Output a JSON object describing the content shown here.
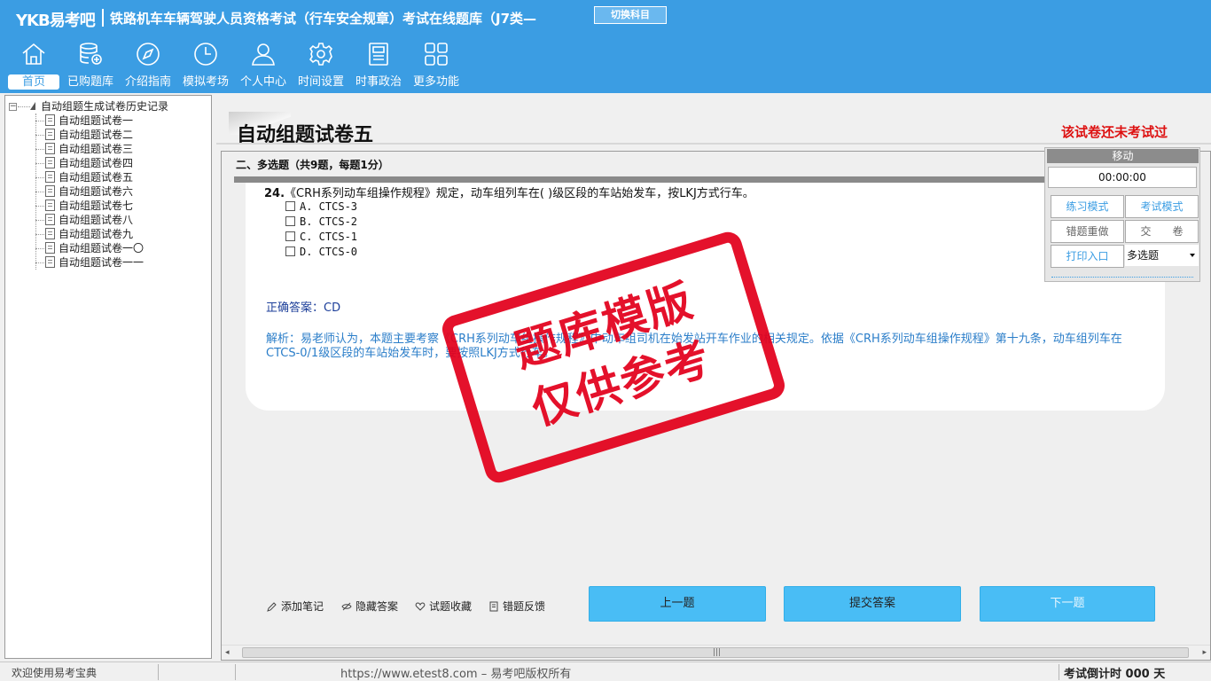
{
  "header": {
    "logo": "YKB易考吧",
    "title": "铁路机车车辆驾驶人员资格考试（行车安全规章）考试在线题库（J7类—",
    "switch_label": "切换科目",
    "nav": [
      {
        "label": "首页",
        "icon": "home-icon"
      },
      {
        "label": "已购题库",
        "icon": "database-icon"
      },
      {
        "label": "介绍指南",
        "icon": "compass-icon"
      },
      {
        "label": "模拟考场",
        "icon": "clock-icon"
      },
      {
        "label": "个人中心",
        "icon": "user-icon"
      },
      {
        "label": "时间设置",
        "icon": "gear-icon"
      },
      {
        "label": "时事政治",
        "icon": "newspaper-icon"
      },
      {
        "label": "更多功能",
        "icon": "grid-icon"
      }
    ]
  },
  "sidebar": {
    "root_label": "自动组题生成试卷历史记录",
    "items": [
      "自动组题试卷一",
      "自动组题试卷二",
      "自动组题试卷三",
      "自动组题试卷四",
      "自动组题试卷五",
      "自动组题试卷六",
      "自动组题试卷七",
      "自动组题试卷八",
      "自动组题试卷九",
      "自动组题试卷一〇",
      "自动组题试卷一一"
    ]
  },
  "paper": {
    "title": "自动组题试卷五",
    "status": "该试卷还未考试过",
    "section": "二、多选题（共9题，每题1分）"
  },
  "question": {
    "number": "24.",
    "text": "《CRH系列动车组操作规程》规定，动车组列车在( )级区段的车站始发车，按LKJ方式行车。",
    "options": [
      "A. CTCS-3",
      "B. CTCS-2",
      "C. CTCS-1",
      "D. CTCS-0"
    ],
    "answer_label": "正确答案：",
    "answer": "CD",
    "analysis": "解析：易老师认为，本题主要考察《CRH系列动车组操作规程》中动车组司机在始发站开车作业的相关规定。依据《CRH系列动车组操作规程》第十九条，动车组列车在CTCS-0/1级区段的车站始发车时，要按照LKJ方式行车。"
  },
  "stamp": {
    "line1": "题库模版",
    "line2": "仅供参考"
  },
  "panel": {
    "move": "移动",
    "timer": "00:00:00",
    "practice_mode": "练习模式",
    "exam_mode": "考试模式",
    "redo_wrong": "错题重做",
    "submit_paper": "交　　卷",
    "print_entry": "打印入口",
    "question_type": "多选题"
  },
  "tools": {
    "add_note": "添加笔记",
    "hide_answer": "隐藏答案",
    "favorite": "试题收藏",
    "feedback": "错题反馈"
  },
  "buttons": {
    "prev": "上一题",
    "submit": "提交答案",
    "next": "下一题"
  },
  "statusbar": {
    "welcome": "欢迎使用易考宝典",
    "copyright": "https://www.etest8.com – 易考吧版权所有",
    "countdown": "考试倒计时 000 天"
  },
  "colors": {
    "header_bg": "#3b9de3",
    "accent_button": "#49bdf5",
    "status_red": "#d11111",
    "stamp_red": "#e3001b",
    "answer_blue": "#1d3f9a",
    "analysis_blue": "#2b7ec9"
  }
}
